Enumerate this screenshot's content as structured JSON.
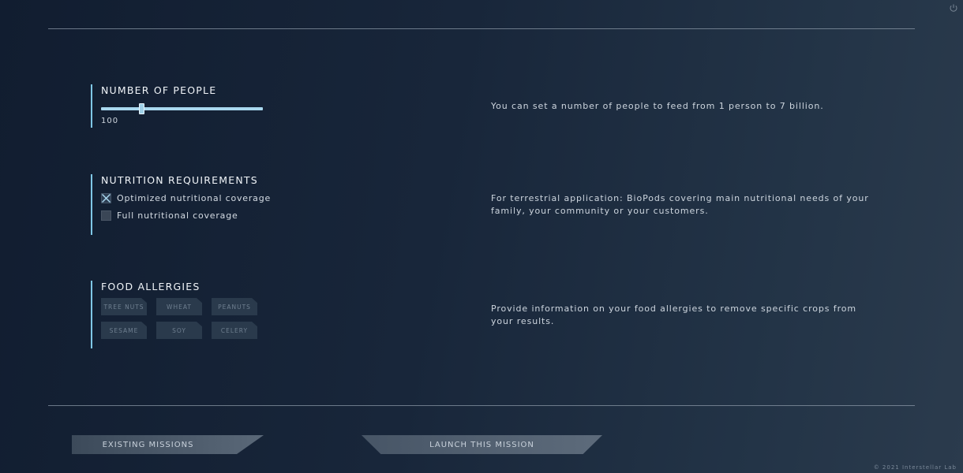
{
  "icons": {
    "power": "power-icon",
    "checked": "x-checkbox-icon"
  },
  "colors": {
    "accent": "#7fc7e6",
    "background": "#18263a",
    "chip": "#2a3a4c"
  },
  "people": {
    "title": "NUMBER OF PEOPLE",
    "slider_value": "100",
    "slider_fraction": 0.24,
    "description": "You can set a number of people to feed from 1 person to 7 billion."
  },
  "nutrition": {
    "title": "NUTRITION REQUIREMENTS",
    "options": [
      {
        "label": "Optimized nutritional coverage",
        "checked": true
      },
      {
        "label": "Full nutritional coverage",
        "checked": false
      }
    ],
    "description": "For terrestrial application: BioPods covering main nutritional needs of your family, your community or your customers."
  },
  "allergies": {
    "title": "FOOD ALLERGIES",
    "chips": [
      "TREE NUTS",
      "WHEAT",
      "PEANUTS",
      "SESAME",
      "SOY",
      "CELERY"
    ],
    "description": "Provide information on your food allergies to remove specific crops from your results."
  },
  "buttons": {
    "existing": "EXISTING MISSIONS",
    "launch": "LAUNCH THIS MISSION"
  },
  "footer": {
    "copyright": "© 2021 Interstellar Lab"
  }
}
